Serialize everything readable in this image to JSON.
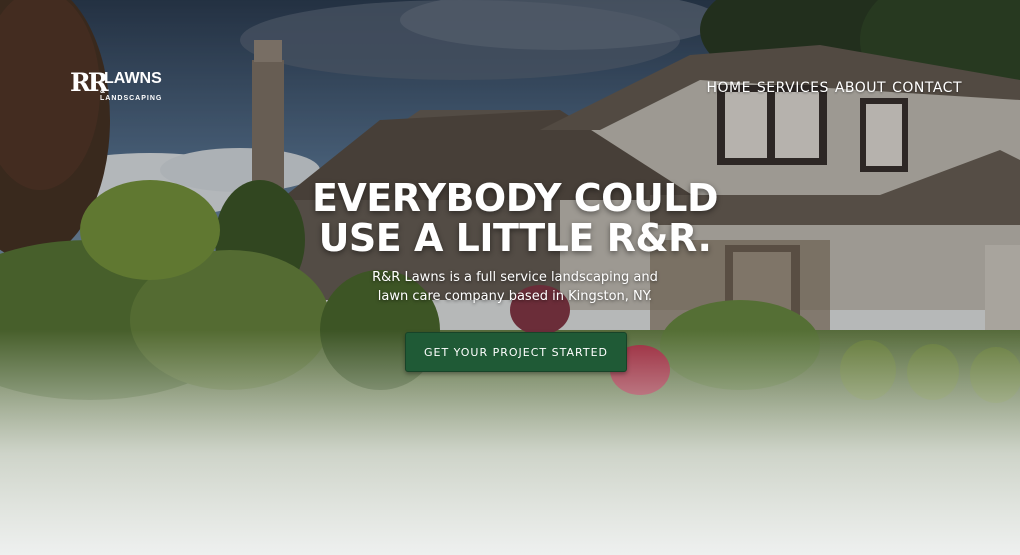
{
  "brand": {
    "logo_mark": "RR",
    "name": "LAWNS",
    "tagline": "& LANDSCAPING"
  },
  "nav": {
    "items": [
      "HOME",
      "SERVICES",
      "ABOUT",
      "CONTACT"
    ]
  },
  "hero": {
    "headline_line1": "EVERYBODY COULD",
    "headline_line2": "USE A LITTLE R&R.",
    "subtitle_line1": "R&R Lawns is a full service landscaping and",
    "subtitle_line2": "lawn care company based in Kingston, NY.",
    "cta_label": "GET YOUR PROJECT STARTED"
  },
  "colors": {
    "cta_background": "#1f5a36",
    "text": "#ffffff",
    "sky": "#4d6a85",
    "lawn_fade": "#eef0ef"
  }
}
